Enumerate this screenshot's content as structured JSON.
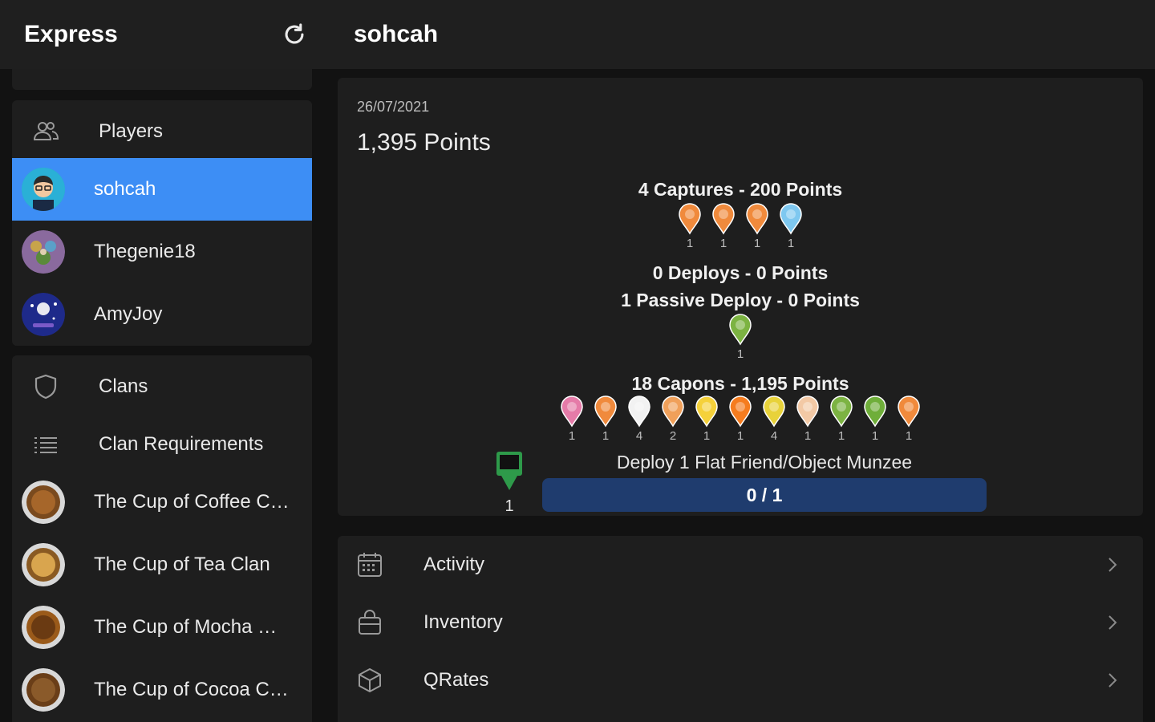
{
  "header": {
    "app_title": "Express",
    "page_title": "sohcah"
  },
  "sidebar": {
    "players_heading": "Players",
    "players": [
      {
        "name": "sohcah",
        "selected": true
      },
      {
        "name": "Thegenie18",
        "selected": false
      },
      {
        "name": "AmyJoy",
        "selected": false
      }
    ],
    "clans_heading": "Clans",
    "clan_requirements": "Clan Requirements",
    "clans": [
      {
        "name": "The Cup of Coffee C…",
        "ring": "#c28a4a"
      },
      {
        "name": "The Cup of Tea Clan",
        "ring": "#d2a15c"
      },
      {
        "name": "The Cup of Mocha …",
        "ring": "#b87a3a"
      },
      {
        "name": "The Cup of Cocoa C…",
        "ring": "#9c6a34"
      }
    ]
  },
  "activity": {
    "date": "26/07/2021",
    "total_points": "1,395 Points",
    "captures_title": "4 Captures - 200 Points",
    "captures": [
      {
        "color": "#f08a3c",
        "count": "1"
      },
      {
        "color": "#f08a3c",
        "count": "1"
      },
      {
        "color": "#f08a3c",
        "count": "1"
      },
      {
        "color": "#7ec8f0",
        "count": "1"
      }
    ],
    "deploys_title": "0 Deploys - 0 Points",
    "passive_title": "1 Passive Deploy - 0 Points",
    "passive": [
      {
        "color": "#7cb342",
        "count": "1"
      }
    ],
    "capons_title": "18 Capons - 1,195 Points",
    "capons": [
      {
        "color": "#e57ba8",
        "count": "1"
      },
      {
        "color": "#f08a3c",
        "count": "1"
      },
      {
        "color": "#f2f2f2",
        "count": "4"
      },
      {
        "color": "#f0a05a",
        "count": "2"
      },
      {
        "color": "#f5d13a",
        "count": "1"
      },
      {
        "color": "#f57c1f",
        "count": "1"
      },
      {
        "color": "#e8d23a",
        "count": "4"
      },
      {
        "color": "#f3c9a5",
        "count": "1"
      },
      {
        "color": "#7cb342",
        "count": "1"
      },
      {
        "color": "#6fae3a",
        "count": "1"
      },
      {
        "color": "#f08a3c",
        "count": "1"
      }
    ],
    "requirement_count": "1",
    "requirement_text": "Deploy 1 Flat Friend/Object Munzee",
    "progress_text": "0 / 1",
    "progress_fraction": 0
  },
  "menu": [
    {
      "label": "Activity",
      "icon": "calendar-icon"
    },
    {
      "label": "Inventory",
      "icon": "bag-icon"
    },
    {
      "label": "QRates",
      "icon": "cube-icon"
    }
  ],
  "colors": {
    "accent": "#3d8ef5",
    "background": "#121212",
    "card": "#1e1e1e"
  }
}
